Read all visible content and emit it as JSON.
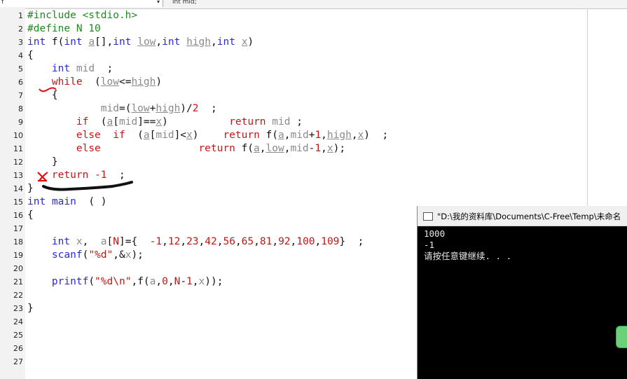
{
  "toolbar": {
    "scope_value": "f",
    "function_text": "int mid;"
  },
  "editor": {
    "lines": [
      {
        "n": "1",
        "t": [
          [
            "pp",
            "#include <stdio.h>"
          ]
        ]
      },
      {
        "n": "2",
        "t": [
          [
            "pp",
            "#define N 10"
          ]
        ]
      },
      {
        "n": "3",
        "t": [
          [
            "kw",
            "int"
          ],
          [
            "plain",
            " f("
          ],
          [
            "kw",
            "int"
          ],
          [
            "plain",
            " "
          ],
          [
            "prm",
            "a"
          ],
          [
            "plain",
            "[],"
          ],
          [
            "kw",
            "int"
          ],
          [
            "plain",
            " "
          ],
          [
            "prm",
            "low"
          ],
          [
            "plain",
            ","
          ],
          [
            "kw",
            "int"
          ],
          [
            "plain",
            " "
          ],
          [
            "prm",
            "high"
          ],
          [
            "plain",
            ","
          ],
          [
            "kw",
            "int"
          ],
          [
            "plain",
            " "
          ],
          [
            "prm",
            "x"
          ],
          [
            "plain",
            ")"
          ]
        ]
      },
      {
        "n": "4",
        "t": [
          [
            "plain",
            "{"
          ]
        ]
      },
      {
        "n": "5",
        "t": [
          [
            "plain",
            "    "
          ],
          [
            "kw",
            "int"
          ],
          [
            "plain",
            " "
          ],
          [
            "id",
            "mid"
          ],
          [
            "plain",
            "  ;"
          ]
        ]
      },
      {
        "n": "6",
        "t": [
          [
            "plain",
            "    "
          ],
          [
            "ctl",
            "while"
          ],
          [
            "plain",
            "  ("
          ],
          [
            "prm",
            "low"
          ],
          [
            "plain",
            "<="
          ],
          [
            "prm",
            "high"
          ],
          [
            "plain",
            ")"
          ]
        ]
      },
      {
        "n": "7",
        "t": [
          [
            "plain",
            "    {"
          ]
        ]
      },
      {
        "n": "8",
        "t": [
          [
            "plain",
            "            "
          ],
          [
            "id",
            "mid"
          ],
          [
            "plain",
            "=("
          ],
          [
            "prm",
            "low"
          ],
          [
            "plain",
            "+"
          ],
          [
            "prm",
            "high"
          ],
          [
            "plain",
            ")/"
          ],
          [
            "num",
            "2"
          ],
          [
            "plain",
            "  ;"
          ]
        ]
      },
      {
        "n": "9",
        "t": [
          [
            "plain",
            "        "
          ],
          [
            "ctl",
            "if"
          ],
          [
            "plain",
            "  ("
          ],
          [
            "prm",
            "a"
          ],
          [
            "plain",
            "["
          ],
          [
            "id",
            "mid"
          ],
          [
            "plain",
            "]=="
          ],
          [
            "prm",
            "x"
          ],
          [
            "plain",
            ")          "
          ],
          [
            "ctl",
            "return"
          ],
          [
            "plain",
            " "
          ],
          [
            "id",
            "mid"
          ],
          [
            "plain",
            " ;"
          ]
        ]
      },
      {
        "n": "10",
        "t": [
          [
            "plain",
            "        "
          ],
          [
            "ctl",
            "else"
          ],
          [
            "plain",
            "  "
          ],
          [
            "ctl",
            "if"
          ],
          [
            "plain",
            "  ("
          ],
          [
            "prm",
            "a"
          ],
          [
            "plain",
            "["
          ],
          [
            "id",
            "mid"
          ],
          [
            "plain",
            "]<"
          ],
          [
            "prm",
            "x"
          ],
          [
            "plain",
            ")    "
          ],
          [
            "ctl",
            "return"
          ],
          [
            "plain",
            " f("
          ],
          [
            "prm",
            "a"
          ],
          [
            "plain",
            ","
          ],
          [
            "id",
            "mid"
          ],
          [
            "plain",
            "+"
          ],
          [
            "num",
            "1"
          ],
          [
            "plain",
            ","
          ],
          [
            "prm",
            "high"
          ],
          [
            "plain",
            ","
          ],
          [
            "prm",
            "x"
          ],
          [
            "plain",
            ")  ;"
          ]
        ]
      },
      {
        "n": "11",
        "t": [
          [
            "plain",
            "        "
          ],
          [
            "ctl",
            "else"
          ],
          [
            "plain",
            "                "
          ],
          [
            "ctl",
            "return"
          ],
          [
            "plain",
            " f("
          ],
          [
            "prm",
            "a"
          ],
          [
            "plain",
            ","
          ],
          [
            "prm",
            "low"
          ],
          [
            "plain",
            ","
          ],
          [
            "id",
            "mid"
          ],
          [
            "plain",
            "-"
          ],
          [
            "num",
            "1"
          ],
          [
            "plain",
            ","
          ],
          [
            "prm",
            "x"
          ],
          [
            "plain",
            ");"
          ]
        ]
      },
      {
        "n": "12",
        "t": [
          [
            "plain",
            "    }"
          ]
        ]
      },
      {
        "n": "13",
        "t": [
          [
            "plain",
            "    "
          ],
          [
            "ctl",
            "return"
          ],
          [
            "plain",
            " "
          ],
          [
            "num",
            "-1"
          ],
          [
            "plain",
            "  ;"
          ]
        ]
      },
      {
        "n": "14",
        "t": [
          [
            "plain",
            "}"
          ]
        ]
      },
      {
        "n": "15",
        "t": [
          [
            "kw",
            "int"
          ],
          [
            "plain",
            " "
          ],
          [
            "kw",
            "main"
          ],
          [
            "plain",
            "  ( )"
          ]
        ]
      },
      {
        "n": "16",
        "t": [
          [
            "plain",
            "{"
          ]
        ]
      },
      {
        "n": "17",
        "t": []
      },
      {
        "n": "18",
        "t": [
          [
            "plain",
            "    "
          ],
          [
            "kw",
            "int"
          ],
          [
            "plain",
            " "
          ],
          [
            "id",
            "x"
          ],
          [
            "plain",
            ",  "
          ],
          [
            "id",
            "a"
          ],
          [
            "plain",
            "["
          ],
          [
            "const",
            "N"
          ],
          [
            "plain",
            "]={  "
          ],
          [
            "num",
            "-1"
          ],
          [
            "plain",
            ","
          ],
          [
            "num",
            "12"
          ],
          [
            "plain",
            ","
          ],
          [
            "num",
            "23"
          ],
          [
            "plain",
            ","
          ],
          [
            "num",
            "42"
          ],
          [
            "plain",
            ","
          ],
          [
            "num",
            "56"
          ],
          [
            "plain",
            ","
          ],
          [
            "num",
            "65"
          ],
          [
            "plain",
            ","
          ],
          [
            "num",
            "81"
          ],
          [
            "plain",
            ","
          ],
          [
            "num",
            "92"
          ],
          [
            "plain",
            ","
          ],
          [
            "num",
            "100"
          ],
          [
            "plain",
            ","
          ],
          [
            "num",
            "109"
          ],
          [
            "plain",
            "}  ;"
          ]
        ]
      },
      {
        "n": "19",
        "t": [
          [
            "plain",
            "    "
          ],
          [
            "kw",
            "scanf"
          ],
          [
            "plain",
            "("
          ],
          [
            "str",
            "\"%d\""
          ],
          [
            "plain",
            ",&"
          ],
          [
            "id",
            "x"
          ],
          [
            "plain",
            ");"
          ]
        ]
      },
      {
        "n": "20",
        "t": []
      },
      {
        "n": "21",
        "t": [
          [
            "plain",
            "    "
          ],
          [
            "kw",
            "printf"
          ],
          [
            "plain",
            "("
          ],
          [
            "str",
            "\"%d\\n\""
          ],
          [
            "plain",
            ",f("
          ],
          [
            "id",
            "a"
          ],
          [
            "plain",
            ","
          ],
          [
            "num",
            "0"
          ],
          [
            "plain",
            ","
          ],
          [
            "const",
            "N"
          ],
          [
            "plain",
            "-"
          ],
          [
            "num",
            "1"
          ],
          [
            "plain",
            ","
          ],
          [
            "id",
            "x"
          ],
          [
            "plain",
            "));"
          ]
        ]
      },
      {
        "n": "22",
        "t": []
      },
      {
        "n": "23",
        "t": [
          [
            "plain",
            "}"
          ]
        ]
      },
      {
        "n": "24",
        "t": []
      },
      {
        "n": "25",
        "t": []
      },
      {
        "n": "26",
        "t": []
      },
      {
        "n": "27",
        "t": []
      }
    ]
  },
  "console": {
    "title": "\"D:\\我的资料库\\Documents\\C-Free\\Temp\\未命名",
    "lines": [
      "1000",
      "-1",
      "请按任意键继续. . ."
    ]
  },
  "colors": {
    "preprocessor": "#1f8a1f",
    "keyword": "#2a2ad6",
    "control": "#c41616",
    "identifier": "#8a8a8a"
  }
}
